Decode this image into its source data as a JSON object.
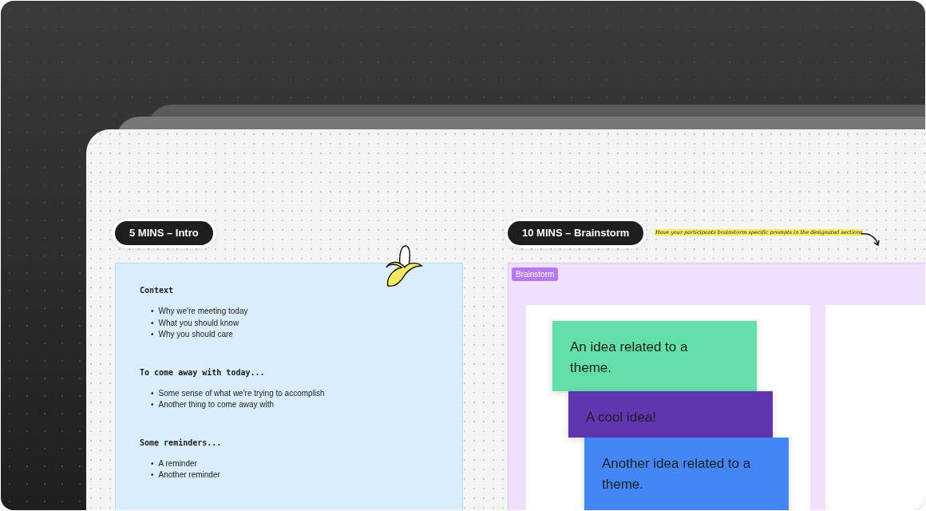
{
  "intro": {
    "pill": "5 MINS – Intro",
    "blocks": [
      {
        "heading": "Context",
        "bullet": "•",
        "items": [
          "Why we're meeting today",
          "What you should know",
          "Why you should care"
        ]
      },
      {
        "heading": "To come away with today...",
        "bullet": "•",
        "items": [
          "Some sense of what we're trying to accomplish",
          "Another thing to come away with"
        ]
      },
      {
        "heading": "Some reminders...",
        "bullet": "•",
        "items": [
          "A reminder",
          "Another reminder"
        ]
      }
    ]
  },
  "brainstorm": {
    "pill": "10 MINS – Brainstorm",
    "annotation": "Have your participants brainstorm specific prompts in the designated sections",
    "section_label": "Brainstorm",
    "notes": [
      {
        "text": "An idea related to a theme.",
        "color": "#62e0a8"
      },
      {
        "text": "A cool idea!",
        "color": "#5f35b0"
      },
      {
        "text": "Another idea related to a theme.",
        "color": "#4287f5"
      }
    ]
  }
}
